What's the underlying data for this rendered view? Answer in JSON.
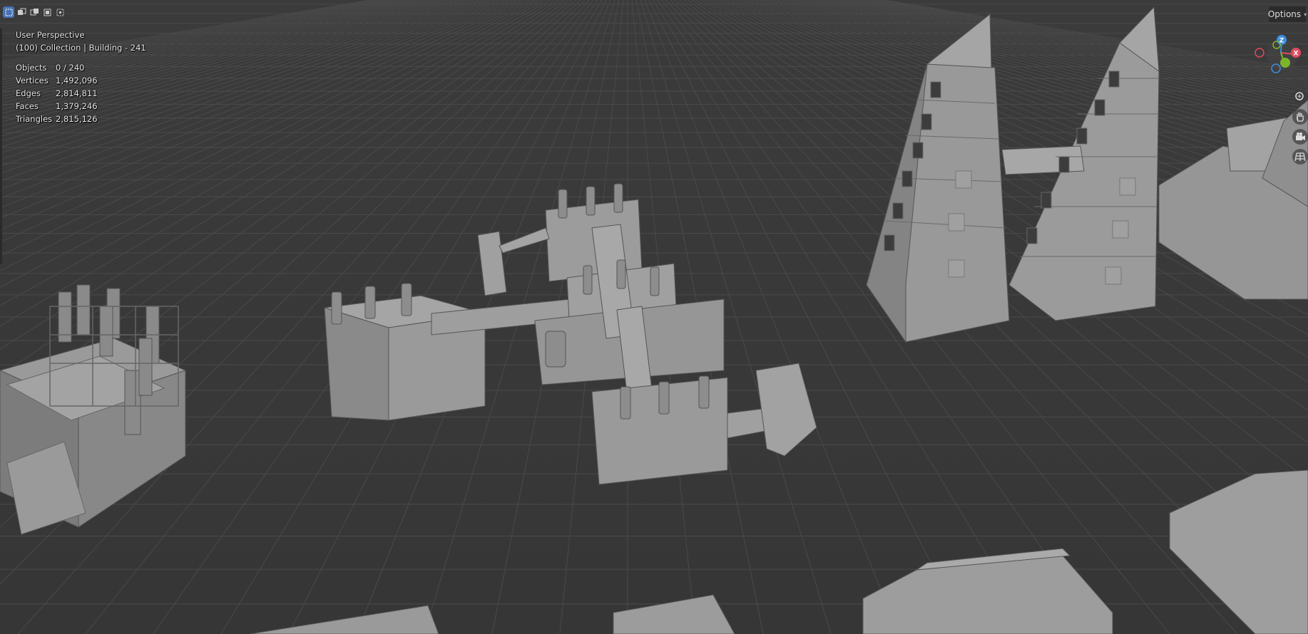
{
  "viewport": {
    "perspective_label": "User Perspective",
    "collection_label": "(100) Collection | Building - 241"
  },
  "stats": [
    {
      "label": "Objects",
      "value": "0 / 240"
    },
    {
      "label": "Vertices",
      "value": "1,492,096"
    },
    {
      "label": "Edges",
      "value": "2,814,811"
    },
    {
      "label": "Faces",
      "value": "1,379,246"
    },
    {
      "label": "Triangles",
      "value": "2,815,126"
    }
  ],
  "header": {
    "options_label": "Options",
    "select_modes": [
      "select-box-new-icon",
      "select-box-extend-icon",
      "select-box-subtract-icon",
      "select-box-invert-icon",
      "select-box-intersect-icon"
    ]
  },
  "gizmo": {
    "z_label": "Z",
    "x_label": "X",
    "colors": {
      "x": "#e04a5f",
      "y": "#7cb52b",
      "z": "#3d8ee0"
    }
  },
  "nav_tools": [
    "zoom-icon",
    "pan-hand-icon",
    "camera-icon",
    "ortho-grid-icon"
  ],
  "colors": {
    "background": "#393939",
    "accent": "#4772b3",
    "model_gray": "#8e8e8e"
  }
}
